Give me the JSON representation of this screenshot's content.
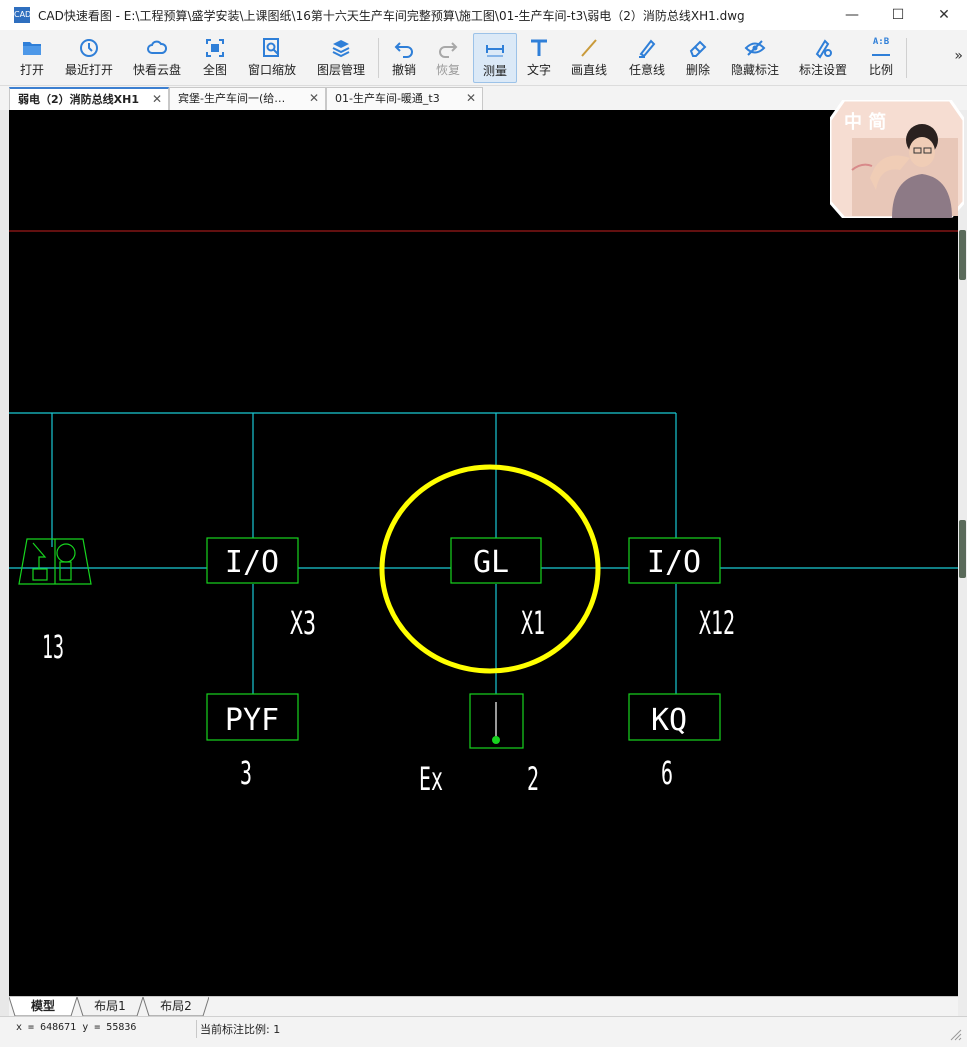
{
  "window": {
    "icon_text": "CAD",
    "title": "CAD快速看图 - E:\\工程预算\\盛学安装\\上课图纸\\16第十六天生产车间完整预算\\施工图\\01-生产车间-t3\\弱电（2）消防总线XH1.dwg",
    "minimize": "—",
    "maximize": "☐",
    "close": "✕"
  },
  "toolbar": {
    "items": [
      {
        "label": "打开",
        "icon": "folder-icon"
      },
      {
        "label": "最近打开",
        "icon": "history-icon"
      },
      {
        "label": "快看云盘",
        "icon": "cloud-icon"
      },
      {
        "label": "全图",
        "icon": "fit-icon"
      },
      {
        "label": "窗口缩放",
        "icon": "zoom-window-icon"
      },
      {
        "label": "图层管理",
        "icon": "layers-icon"
      },
      {
        "label": "撤销",
        "icon": "undo-icon"
      },
      {
        "label": "恢复",
        "icon": "redo-icon"
      },
      {
        "label": "测量",
        "icon": "measure-icon"
      },
      {
        "label": "文字",
        "icon": "text-icon"
      },
      {
        "label": "画直线",
        "icon": "line-icon"
      },
      {
        "label": "任意线",
        "icon": "pen-icon"
      },
      {
        "label": "删除",
        "icon": "eraser-icon"
      },
      {
        "label": "隐藏标注",
        "icon": "eye-hide-icon"
      },
      {
        "label": "标注设置",
        "icon": "annotation-settings-icon"
      },
      {
        "label": "比例",
        "icon": "scale-icon"
      }
    ],
    "more": "»",
    "scale_icon_text": "A:B"
  },
  "tabs": [
    {
      "label": "弱电（2）消防总线XH1",
      "close": "✕"
    },
    {
      "label": "宾堡-生产车间一(给…",
      "close": "✕"
    },
    {
      "label": "01-生产车间-暖通_t3",
      "close": "✕"
    }
  ],
  "drawing": {
    "blocks": {
      "io_left": "I/O",
      "gl": "GL",
      "io_right": "I/O",
      "pyf": "PYF",
      "kq": "KQ"
    },
    "labels": {
      "x3": "X3",
      "x1": "X1",
      "x12": "X12",
      "count_13": "13",
      "count_3": "3",
      "count_2": "2",
      "count_6": "6",
      "ex": "Ex"
    },
    "colors": {
      "background": "#000000",
      "bus_line": "#19c9d4",
      "block_border": "#17d41f",
      "highlight_circle": "#ffff00",
      "red_line": "#c42020",
      "text": "#ffffff"
    }
  },
  "avatar": {
    "text": "中 简"
  },
  "layout_tabs": [
    "模型",
    "布局1",
    "布局2"
  ],
  "status": {
    "coords": "x = 648671  y = 55836",
    "scale_label": "当前标注比例: 1"
  }
}
